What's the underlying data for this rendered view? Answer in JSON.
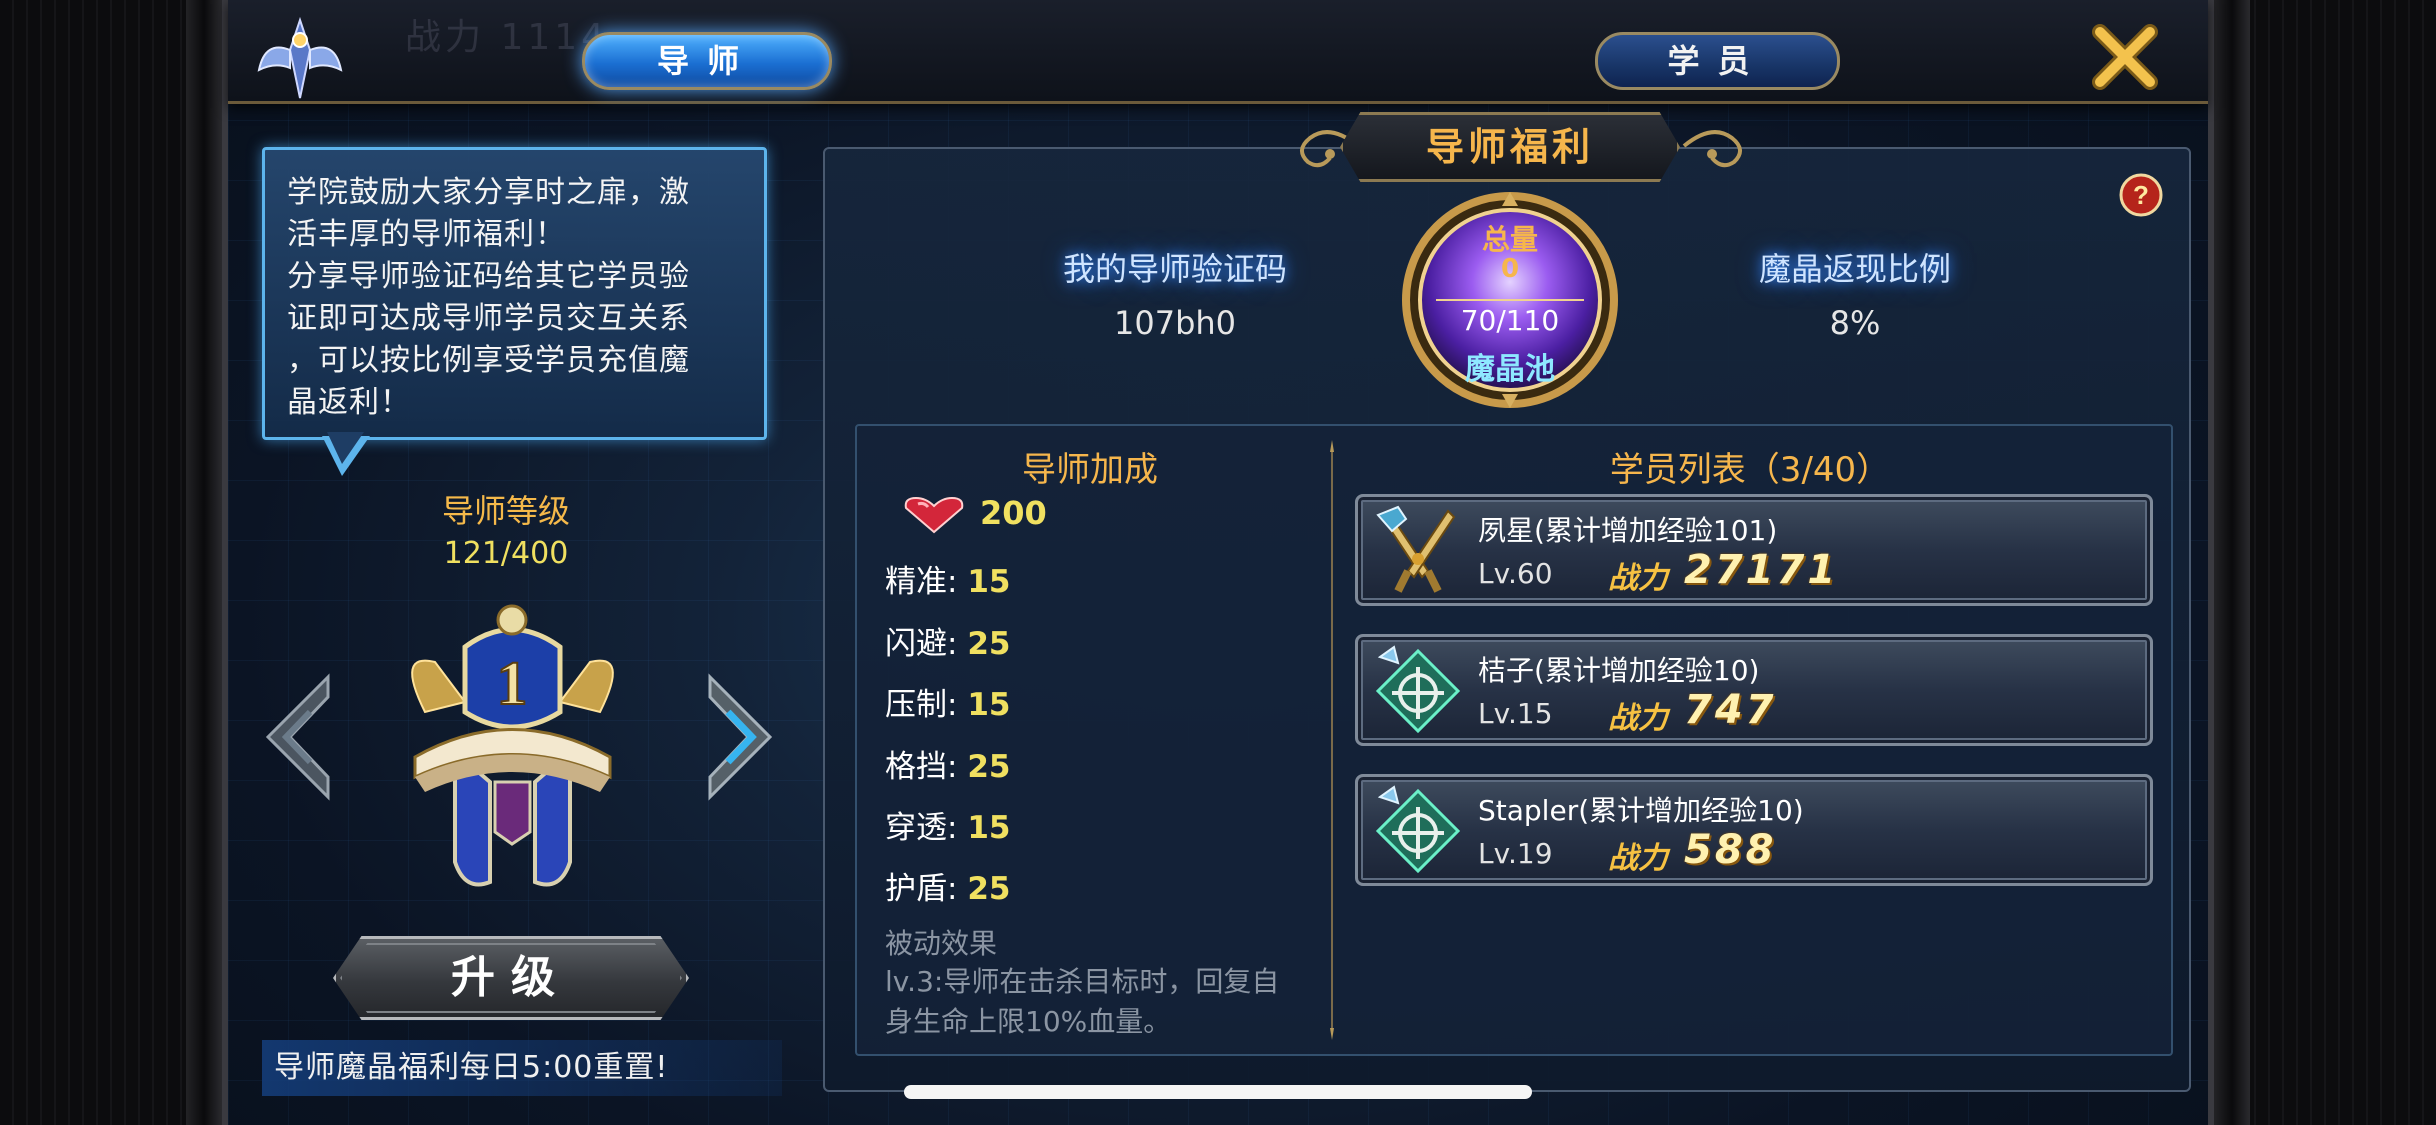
{
  "colors": {
    "accent_gold": "#f6b64c",
    "value_yellow": "#f0e060",
    "tab_active_blue": "#1b6fd2",
    "glow_blue": "#3a8bff",
    "passive_gray": "#8b95a3"
  },
  "header": {
    "background_ghost_text": "战力 1114",
    "emblem_icon": "winged-crest-icon",
    "tabs": [
      {
        "label": "导师",
        "active": true
      },
      {
        "label": "学员",
        "active": false
      }
    ],
    "close_icon": "close-x-icon"
  },
  "left": {
    "intro_lines": [
      "学院鼓励大家分享时之扉，激",
      "活丰厚的导师福利！",
      "分享导师验证码给其它学员验",
      "证即可达成导师学员交互关系",
      "，可以按比例享受学员充值魔",
      "晶返利！"
    ],
    "level_label": "导师等级",
    "level_value": "121/400",
    "badge_number": "1",
    "upgrade_label": "升级",
    "reset_note": "导师魔晶福利每日5:00重置!"
  },
  "panel": {
    "title": "导师福利",
    "help_icon": "question-icon",
    "code_label": "我的导师验证码",
    "code_value": "107bh0",
    "ratio_label": "魔晶返现比例",
    "ratio_value": "8%",
    "pool": {
      "total_label": "总量",
      "total_value": "0",
      "ratio": "70/110",
      "name": "魔晶池"
    }
  },
  "bonus": {
    "title": "导师加成",
    "hp_value": "200",
    "stats": [
      {
        "label": "精准:",
        "value": "15"
      },
      {
        "label": "闪避:",
        "value": "25"
      },
      {
        "label": "压制:",
        "value": "15"
      },
      {
        "label": "格挡:",
        "value": "25"
      },
      {
        "label": "穿透:",
        "value": "15"
      },
      {
        "label": "护盾:",
        "value": "25"
      }
    ],
    "passive_title": "被动效果",
    "passive_text": "lv.3:导师在击杀目标时，回复自身生命上限10%血量。"
  },
  "students": {
    "title": "学员列表（3/40）",
    "power_label": "战力",
    "items": [
      {
        "name": "夙星(累计增加经验101)",
        "level": "Lv.60",
        "power": "27171",
        "icon": "crossed-swords-icon"
      },
      {
        "name": "桔子(累计增加经验10)",
        "level": "Lv.15",
        "power": "747",
        "icon": "crosshair-gem-icon"
      },
      {
        "name": "Stapler(累计增加经验10)",
        "level": "Lv.19",
        "power": "588",
        "icon": "crosshair-gem-icon"
      }
    ]
  }
}
